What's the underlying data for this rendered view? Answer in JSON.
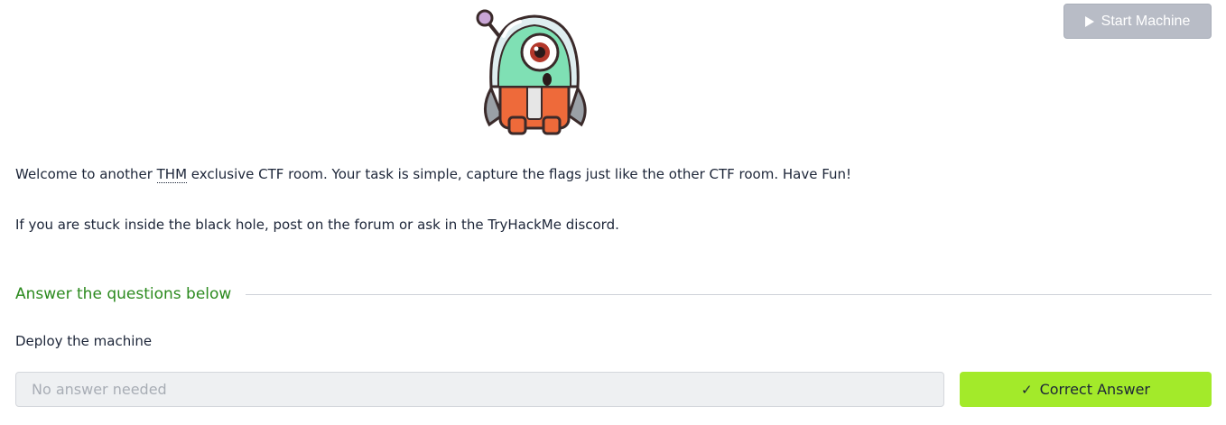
{
  "header": {
    "start_machine_label": "Start Machine",
    "start_machine_icon": "play-icon"
  },
  "mascot": {
    "icon": "alien-mascot-icon"
  },
  "intro": {
    "p1_before": "Welcome to another ",
    "p1_abbr": "THM",
    "p1_after": " exclusive CTF room. Your task is simple, capture the flags just like the other CTF room. Have Fun!",
    "p2": "If you are stuck inside the black hole, post on the forum or ask in the TryHackMe discord."
  },
  "answers": {
    "heading": "Answer the questions below",
    "question": "Deploy the machine",
    "input_placeholder": "No answer needed",
    "correct_label": "Correct Answer",
    "correct_icon": "check-icon"
  },
  "colors": {
    "heading_green": "#2b8a1e",
    "correct_button": "#a3ea2a",
    "disabled_button": "#b8bcc6"
  }
}
